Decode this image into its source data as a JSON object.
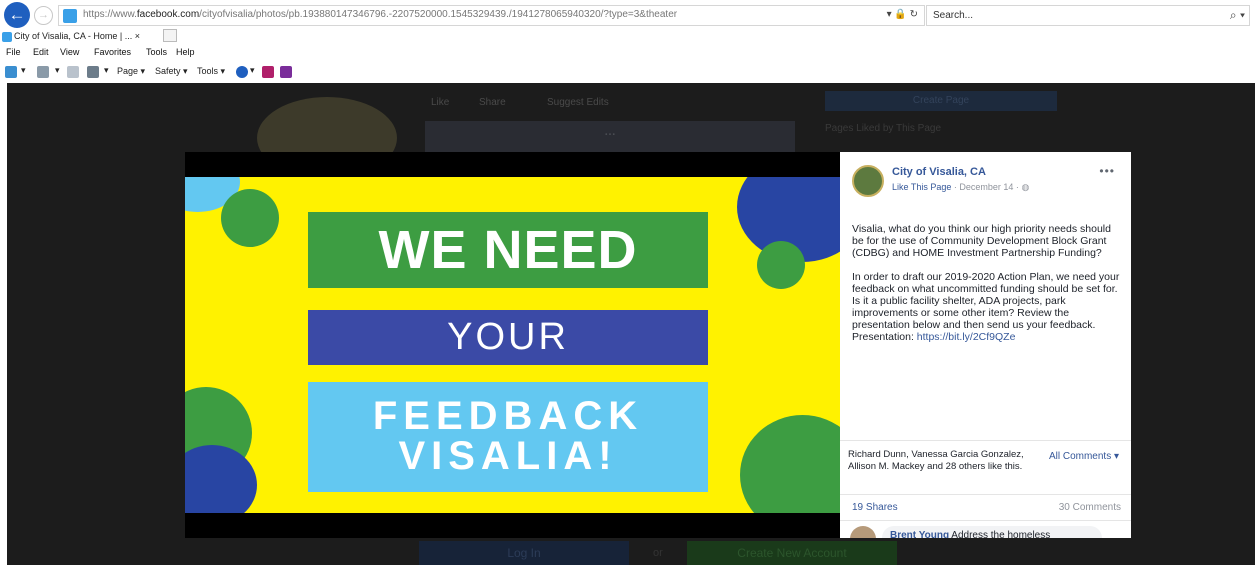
{
  "browser": {
    "url_prefix": "https://www.",
    "url_domain": "facebook.com",
    "url_rest": "/cityofvisalia/photos/pb.193880147346796.-2207520000.1545329439./1941278065940320/?type=3&theater",
    "url_icons": "▾ 🔒 ↻",
    "search_placeholder": "Search...",
    "tab_title": "City of Visalia, CA - Home | ... ×",
    "menu": [
      "File",
      "Edit",
      "View",
      "Favorites",
      "Tools",
      "Help"
    ],
    "commands": [
      "Page ▾",
      "Safety ▾",
      "Tools ▾"
    ]
  },
  "background_page": {
    "nav": [
      "Like",
      "Share",
      "Suggest Edits"
    ],
    "cover_text": "...",
    "create_page": "Create Page",
    "pages_liked": "Pages Liked by This Page",
    "login": "Log In",
    "or": "or",
    "create_account": "Create New Account"
  },
  "photo": {
    "line1": "WE NEED",
    "line2": "YOUR",
    "line3": "FEEDBACK",
    "line4": "VISALIA!",
    "colors": {
      "background": "#fff200",
      "green": "#3d9d42",
      "blue": "#3b4aa6",
      "sky": "#63c8f1",
      "navy": "#2845a3"
    }
  },
  "post": {
    "page_name": "City of Visalia, CA",
    "like_link": "Like This Page",
    "date": "· December 14 ·",
    "globe_icon": "globe-icon",
    "more": "•••",
    "paragraph1": "Visalia, what do you think our high priority needs should be for the use of Community Development Block Grant (CDBG) and HOME Investment Partnership Funding?",
    "paragraph2": "In order to draft our 2019-2020 Action Plan, we need your feedback on what uncommitted funding should be set for. Is it a public facility shelter, ADA projects, park improvements or some other item? Review the presentation below and then send us your feedback.",
    "presentation_label": "Presentation: ",
    "presentation_link": "https://bit.ly/2Cf9QZe",
    "likers": "Richard Dunn, Vanessa Garcia Gonzalez, Allison M. Mackey and 28 others like this.",
    "all_comments": "All Comments ▾",
    "shares": "19 Shares",
    "comments": "30 Comments",
    "comment_author": "Brent Young",
    "comment_text": " Address the homeless"
  }
}
